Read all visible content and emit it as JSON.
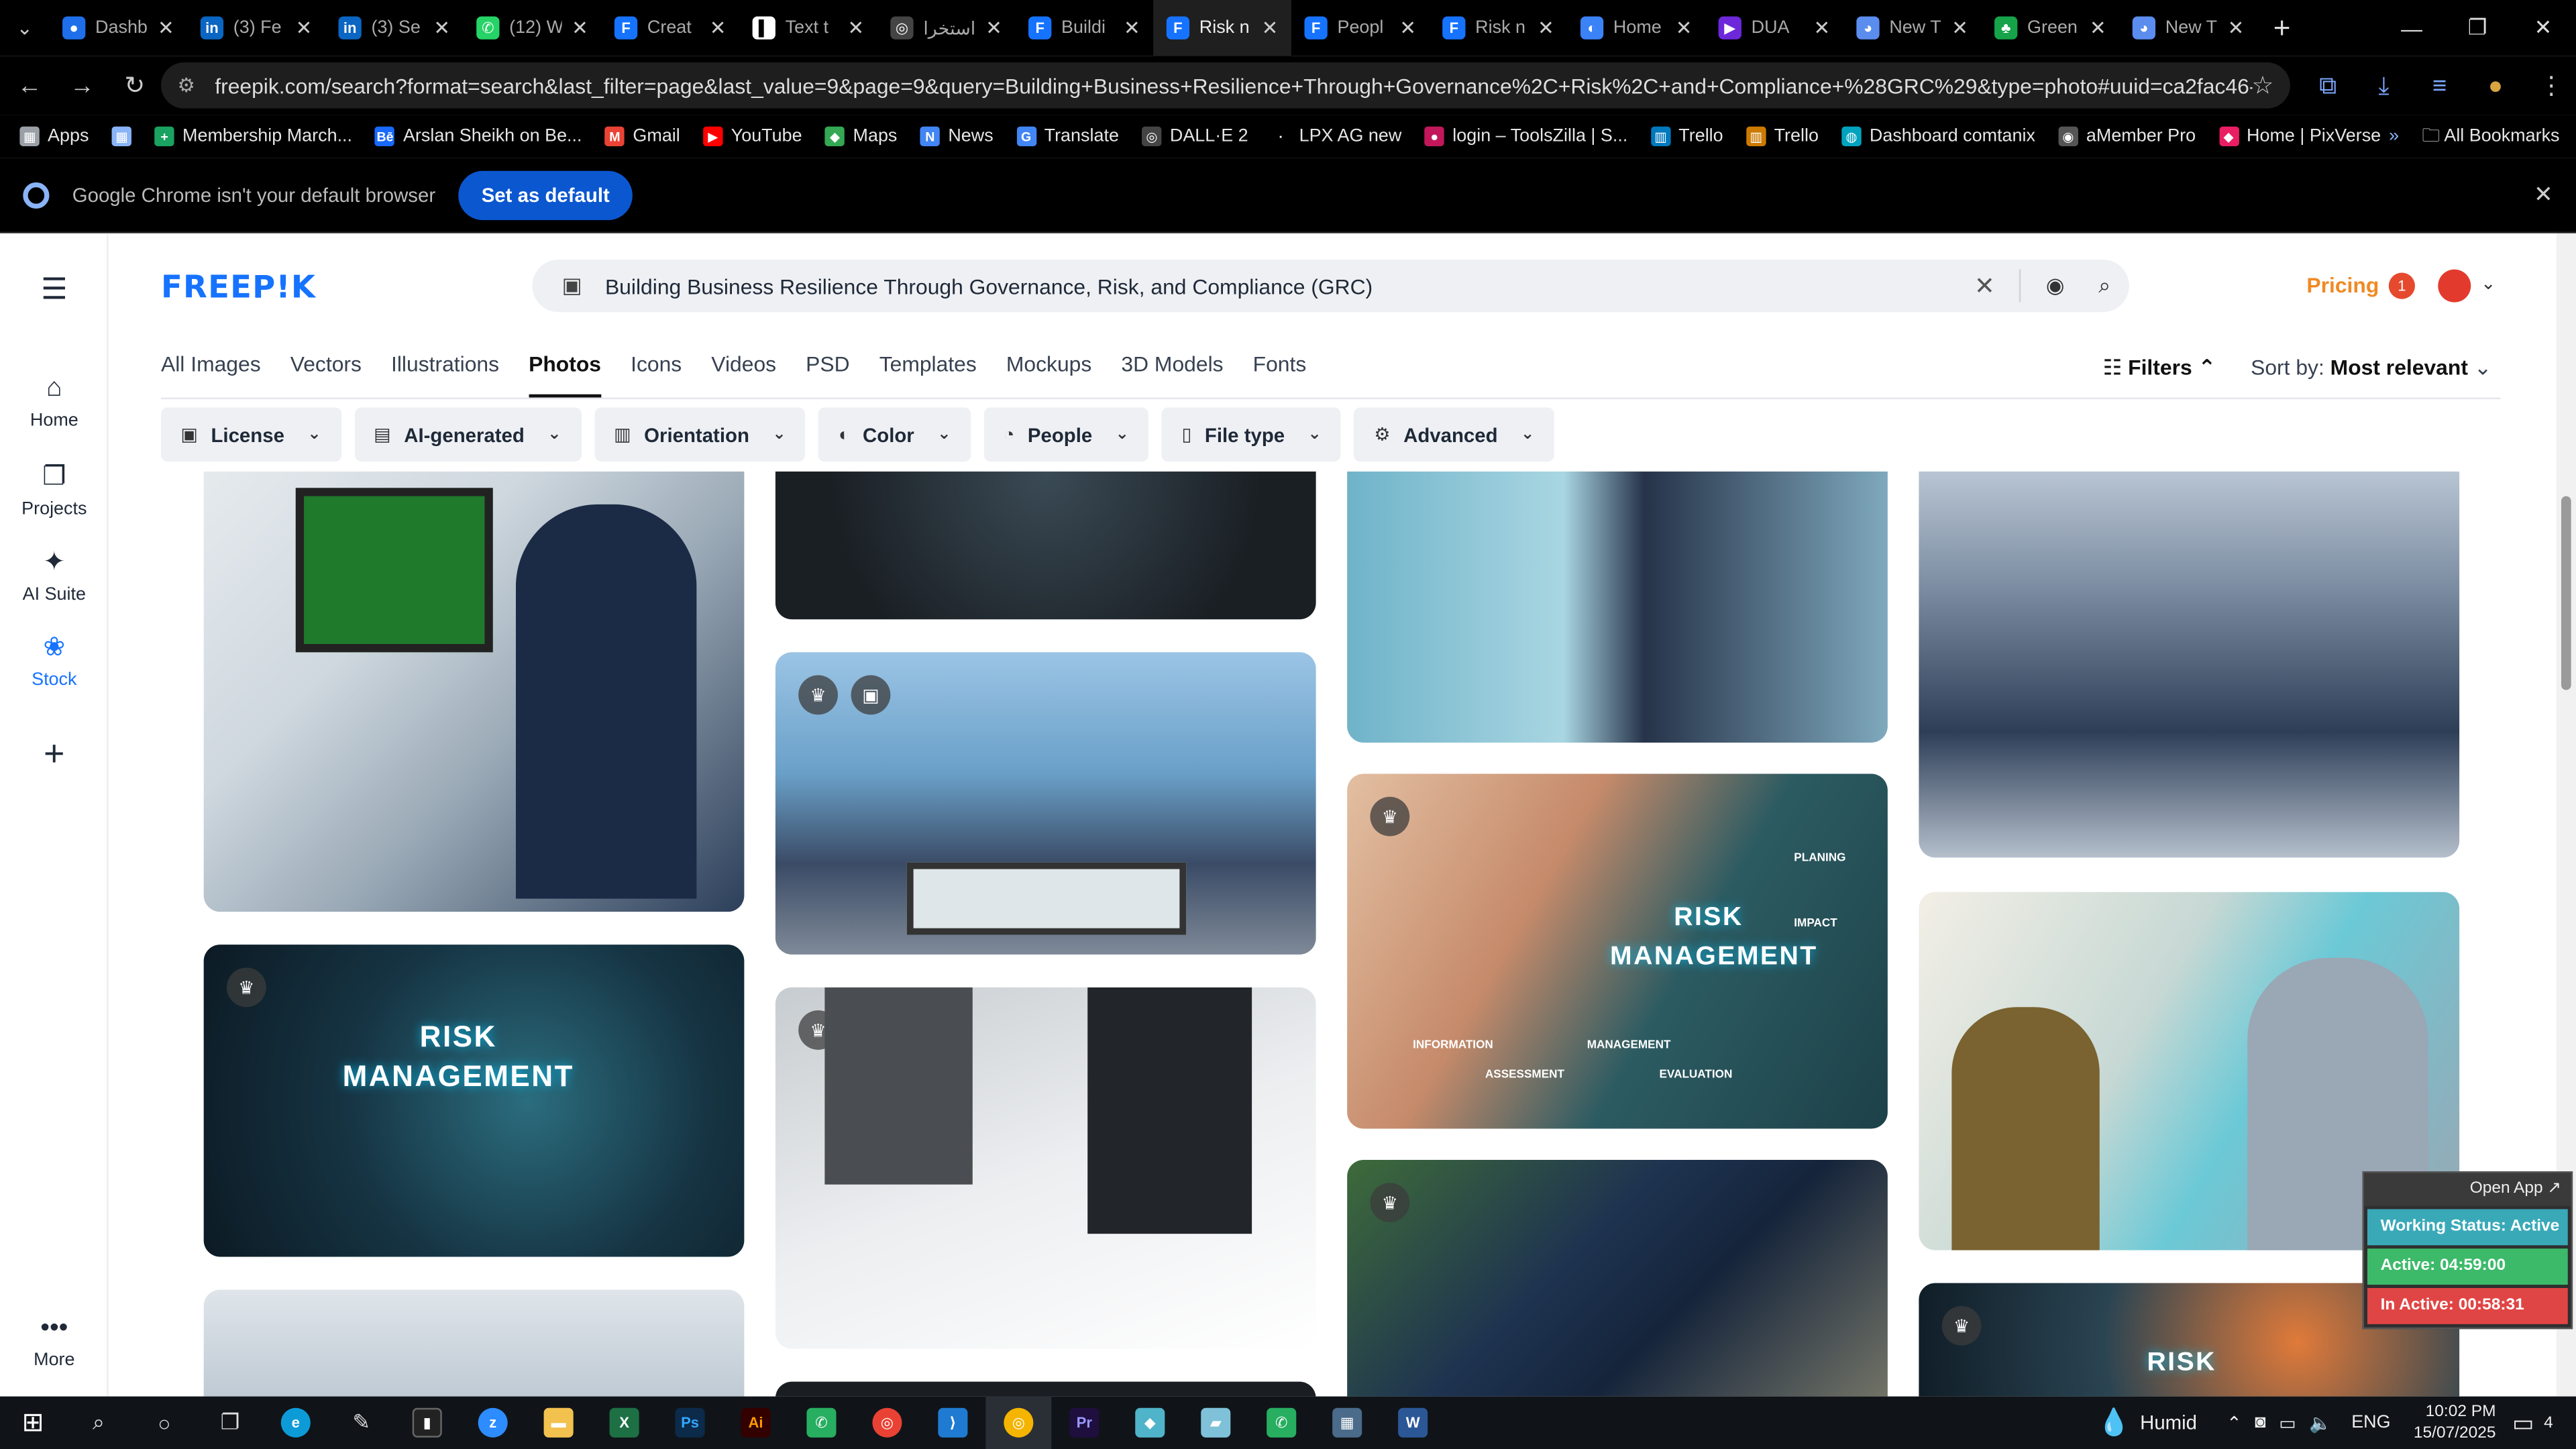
{
  "tabs": [
    {
      "label": "Dashb",
      "color": "#1f6feb",
      "glyph": "●"
    },
    {
      "label": "(3) Fe",
      "color": "#0a66c2",
      "glyph": "in"
    },
    {
      "label": "(3) Se",
      "color": "#0a66c2",
      "glyph": "in"
    },
    {
      "label": "(12) W",
      "color": "#25d366",
      "glyph": "✆"
    },
    {
      "label": "Creat",
      "color": "#1673ff",
      "glyph": "F"
    },
    {
      "label": "Text t",
      "color": "#ffffff",
      "glyph": "▌"
    },
    {
      "label": "استخرا",
      "color": "#444444",
      "glyph": "◎"
    },
    {
      "label": "Buildi",
      "color": "#1673ff",
      "glyph": "F"
    },
    {
      "label": "Risk n",
      "color": "#1673ff",
      "glyph": "F"
    },
    {
      "label": "Peopl",
      "color": "#1673ff",
      "glyph": "F"
    },
    {
      "label": "Risk n",
      "color": "#1673ff",
      "glyph": "F"
    },
    {
      "label": "Home",
      "color": "#3b82f6",
      "glyph": "◐"
    },
    {
      "label": "DUA",
      "color": "#6d28d9",
      "glyph": "▶"
    },
    {
      "label": "New T",
      "color": "#5b8def",
      "glyph": "◕"
    },
    {
      "label": "Green",
      "color": "#16a34a",
      "glyph": "♣"
    },
    {
      "label": "New T",
      "color": "#5b8def",
      "glyph": "◕"
    }
  ],
  "active_tab_index": 8,
  "address": {
    "url": "freepik.com/search?format=search&last_filter=page&last_value=9&page=9&query=Building+Business+Resilience+Through+Governance%2C+Risk%2C+and+Compliance+%28GRC%29&type=photo#uuid=ca2fac46-376d-4ca8-8abf-f91f3712..."
  },
  "bookmarks": [
    {
      "label": "Apps",
      "color": "#9aa0a6",
      "glyph": "▦"
    },
    {
      "label": "",
      "color": "#8ab4f8",
      "glyph": "▦"
    },
    {
      "label": "Membership March...",
      "color": "#1aa260",
      "glyph": "+"
    },
    {
      "label": "Arslan Sheikh on Be...",
      "color": "#1769ff",
      "glyph": "Bē"
    },
    {
      "label": "Gmail",
      "color": "#ea4335",
      "glyph": "M"
    },
    {
      "label": "YouTube",
      "color": "#ff0000",
      "glyph": "▶"
    },
    {
      "label": "Maps",
      "color": "#34a853",
      "glyph": "◆"
    },
    {
      "label": "News",
      "color": "#4285f4",
      "glyph": "N"
    },
    {
      "label": "Translate",
      "color": "#4285f4",
      "glyph": "G"
    },
    {
      "label": "DALL·E 2",
      "color": "#444444",
      "glyph": "◎"
    },
    {
      "label": "LPX AG new",
      "color": "#000000",
      "glyph": "·"
    },
    {
      "label": "login – ToolsZilla | S...",
      "color": "#c2185b",
      "glyph": "●"
    },
    {
      "label": "Trello",
      "color": "#0079bf",
      "glyph": "▥"
    },
    {
      "label": "Trello",
      "color": "#cc7a00",
      "glyph": "▥"
    },
    {
      "label": "Dashboard comtanix",
      "color": "#00a3bf",
      "glyph": "◍"
    },
    {
      "label": "aMember Pro",
      "color": "#555555",
      "glyph": "◉"
    },
    {
      "label": "Home | PixVerse",
      "color": "#e91e63",
      "glyph": "◆"
    }
  ],
  "bookmarks_right": {
    "more": "»",
    "all": "All Bookmarks"
  },
  "infobar": {
    "message": "Google Chrome isn't your default browser",
    "button": "Set as default"
  },
  "leftnav": [
    {
      "label": "Home",
      "icon": "⌂",
      "name": "home"
    },
    {
      "label": "Projects",
      "icon": "❐",
      "name": "projects"
    },
    {
      "label": "AI Suite",
      "icon": "✦",
      "name": "ai-suite"
    },
    {
      "label": "Stock",
      "icon": "❀",
      "name": "stock"
    },
    {
      "label": "",
      "icon": "+",
      "name": "add"
    },
    {
      "label": "More",
      "icon": "•••",
      "name": "more"
    }
  ],
  "logo": "FREEP!K",
  "search": {
    "query": "Building Business Resilience Through Governance, Risk, and Compliance (GRC)"
  },
  "header": {
    "pricing": "Pricing",
    "notifications": "1"
  },
  "content_tabs": [
    "All Images",
    "Vectors",
    "Illustrations",
    "Photos",
    "Icons",
    "Videos",
    "PSD",
    "Templates",
    "Mockups",
    "3D Models",
    "Fonts"
  ],
  "active_content_tab": "Photos",
  "filters_label": "Filters",
  "sort": {
    "label": "Sort by:",
    "value": "Most relevant"
  },
  "chips": [
    {
      "label": "License",
      "icon": "▣"
    },
    {
      "label": "AI-generated",
      "icon": "▤"
    },
    {
      "label": "Orientation",
      "icon": "▥"
    },
    {
      "label": "Color",
      "icon": "◐"
    },
    {
      "label": "People",
      "icon": "◔"
    },
    {
      "label": "File type",
      "icon": "▯"
    },
    {
      "label": "Advanced",
      "icon": "⚙"
    }
  ],
  "image_labels": {
    "risk1": "RISK MANAGEMENT",
    "risk2": "RISK MANAGEMENT",
    "risk2_sub": [
      "PLANING",
      "IMPACT",
      "INFORMATION",
      "ASSESSMENT",
      "MANAGEMENT",
      "EVALUATION"
    ],
    "risk3": "RISK"
  },
  "work_status": {
    "open_app": "Open App ↗",
    "status": "Working Status: Active",
    "active": "Active: 04:59:00",
    "inactive": "In Active: 00:58:31"
  },
  "taskbar": {
    "weather": "Humid",
    "lang": "ENG",
    "time": "10:02 PM",
    "date": "15/07/2025",
    "notifications": "4"
  },
  "colors": {
    "brand": "#1673ff",
    "pricing": "#f08a24"
  }
}
